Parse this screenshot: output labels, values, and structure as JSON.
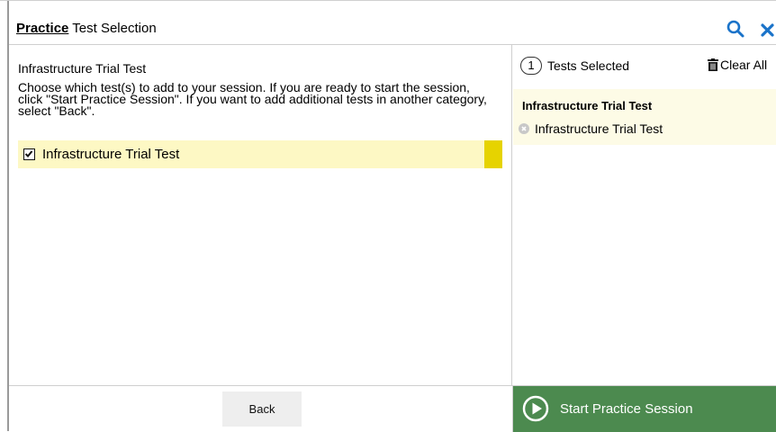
{
  "header": {
    "title_strong": "Practice",
    "title_rest": " Test Selection",
    "search_icon": "search-icon",
    "close_icon": "close-icon",
    "accent_color": "#1a73c9"
  },
  "left_pane": {
    "category_title": "Infrastructure Trial Test",
    "instructions": "Choose which test(s) to add to your session. If you are ready to start the session, click \"Start Practice Session\". If you want to add additional tests in another category, select \"Back\".",
    "tests": [
      {
        "label": "Infrastructure Trial Test",
        "checked": true
      }
    ],
    "row_highlight_color": "#fdf8c4",
    "row_marker_color": "#e6d300"
  },
  "right_pane": {
    "selected_count": "1",
    "selected_label": "Tests Selected",
    "clear_all_label": "Clear All",
    "group_name": "Infrastructure Trial Test",
    "selected_items": [
      {
        "label": "Infrastructure Trial Test"
      }
    ]
  },
  "footer": {
    "back_label": "Back",
    "start_label": "Start Practice Session",
    "start_color": "#4c8a4f"
  }
}
